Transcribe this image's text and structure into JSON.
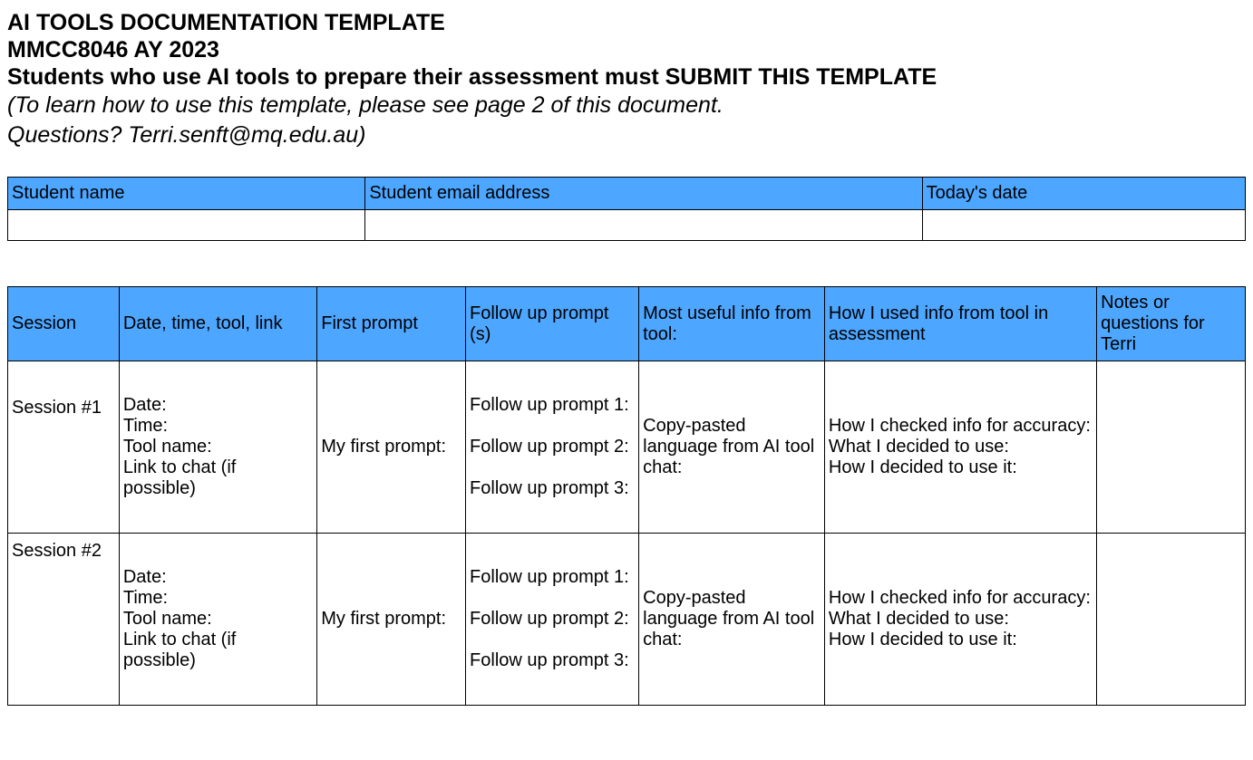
{
  "header": {
    "title1": "AI TOOLS DOCUMENTATION TEMPLATE",
    "title2": "MMCC8046 AY 2023",
    "subtitle": "Students who use AI tools to prepare their assessment must SUBMIT THIS TEMPLATE",
    "italic1": "(To learn how to use this template, please see page 2 of this document.",
    "italic2": "Questions? Terri.senft@mq.edu.au)"
  },
  "info_table": {
    "headers": {
      "name": "Student name",
      "email": "Student email address",
      "date": "Today's date"
    },
    "values": {
      "name": "",
      "email": "",
      "date": ""
    }
  },
  "sessions_table": {
    "headers": {
      "session": "Session",
      "date": "Date, time, tool, link",
      "first": "First prompt",
      "follow": "Follow up prompt (s)",
      "useful": "Most useful info from tool:",
      "how": "How I used info from tool in assessment",
      "notes": "Notes or questions for Terri"
    },
    "rows": [
      {
        "session": "Session #1",
        "date": "Date:\nTime:\nTool name:\nLink to chat (if possible)",
        "first": "My first prompt:",
        "follow": "Follow up prompt 1:\n\nFollow up prompt 2:\n\nFollow up prompt 3:",
        "useful": "Copy-pasted language from AI tool chat:",
        "how": "How I checked info for accuracy:\nWhat I decided to use:\nHow I decided to use it:",
        "notes": ""
      },
      {
        "session": "Session #2",
        "date": "Date:\nTime:\nTool name:\nLink to chat (if possible)",
        "first": "My first prompt:",
        "follow": "Follow up prompt 1:\n\nFollow up prompt 2:\n\nFollow up prompt 3:",
        "useful": "Copy-pasted language from AI tool chat:",
        "how": "How I checked info for accuracy:\nWhat I decided to use:\nHow I decided to use it:",
        "notes": ""
      }
    ]
  }
}
